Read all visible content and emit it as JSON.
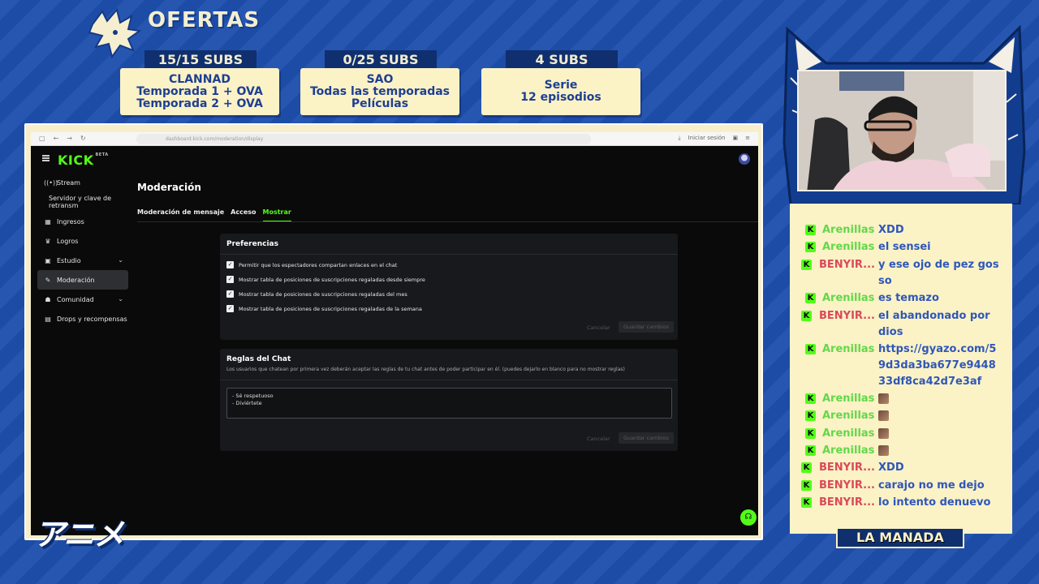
{
  "overlay": {
    "offers_title": "OFERTAS",
    "offers": [
      {
        "tag": "15/15 SUBS",
        "lines": [
          "CLANNAD",
          "Temporada 1 + OVA",
          "Temporada 2 + OVA"
        ]
      },
      {
        "tag": "0/25 SUBS",
        "lines": [
          "SAO",
          "Todas las temporadas",
          "Películas"
        ]
      },
      {
        "tag": "4 SUBS",
        "lines": [
          "Serie",
          "12 episodios"
        ]
      }
    ],
    "bottom_logo": "アニメ",
    "team_label": "LA MANADA",
    "colors": {
      "background": "#1e4fae",
      "card": "#fbf2c6",
      "accent_dark": "#0f2f6e",
      "kick_green": "#53fc18"
    }
  },
  "browser": {
    "url": "dashboard.kick.com/moderation/display",
    "login_label": "Iniciar sesión"
  },
  "kick": {
    "logo": "KICK",
    "logo_badge": "BETA",
    "sidebar": [
      {
        "icon": "stream-icon",
        "glyph": "((•))",
        "label": "Stream"
      },
      {
        "icon": "",
        "glyph": "",
        "label": "Servidor y clave de retransm",
        "sub": true
      },
      {
        "icon": "income-icon",
        "glyph": "▦",
        "label": "Ingresos"
      },
      {
        "icon": "trophy-icon",
        "glyph": "♛",
        "label": "Logros"
      },
      {
        "icon": "studio-icon",
        "glyph": "▣",
        "label": "Estudio",
        "chevron": true
      },
      {
        "icon": "wrench-icon",
        "glyph": "✎",
        "label": "Moderación",
        "active": true
      },
      {
        "icon": "community-icon",
        "glyph": "☗",
        "label": "Comunidad",
        "chevron": true
      },
      {
        "icon": "gift-icon",
        "glyph": "▤",
        "label": "Drops y recompensas"
      }
    ],
    "page_title": "Moderación",
    "tabs": [
      {
        "label": "Moderación de mensaje",
        "active": false
      },
      {
        "label": "Acceso",
        "active": false
      },
      {
        "label": "Mostrar",
        "active": true
      }
    ],
    "preferences": {
      "title": "Preferencias",
      "options": [
        {
          "label": "Permitir que los espectadores compartan enlaces en el chat",
          "checked": true
        },
        {
          "label": "Mostrar tabla de posiciones de suscripciones regaladas desde siempre",
          "checked": true
        },
        {
          "label": "Mostrar tabla de posiciones de suscripciones regaladas del mes",
          "checked": true
        },
        {
          "label": "Mostrar tabla de posiciones de suscripciones regaladas de la semana",
          "checked": true
        }
      ],
      "cancel": "Cancelar",
      "save": "Guardar cambios"
    },
    "chat_rules": {
      "title": "Reglas del Chat",
      "description": "Los usuarios que chatean por primera vez deberán aceptar las reglas de tu chat antes de poder participar en él. (puedes dejarlo en blanco para no mostrar reglas)",
      "value": "- Sé respetuoso\n- Diviértete",
      "cancel": "Cancelar",
      "save": "Guardar cambios"
    }
  },
  "chat": {
    "messages": [
      {
        "user": "Arenillas",
        "color": "green",
        "text": "XDD"
      },
      {
        "user": "Arenillas",
        "color": "green",
        "text": "el sensei"
      },
      {
        "user": "BENYIR...",
        "color": "red",
        "text": "y ese ojo de pez gosso"
      },
      {
        "user": "Arenillas",
        "color": "green",
        "text": "es temazo"
      },
      {
        "user": "BENYIR...",
        "color": "red",
        "text": "el abandonado por dios"
      },
      {
        "user": "Arenillas",
        "color": "green",
        "text": "https://gyazo.com/59d3da3ba677e944833df8ca42d7e3af"
      },
      {
        "user": "Arenillas",
        "color": "green",
        "text": "",
        "emote": true
      },
      {
        "user": "Arenillas",
        "color": "green",
        "text": "",
        "emote": true
      },
      {
        "user": "Arenillas",
        "color": "green",
        "text": "",
        "emote": true
      },
      {
        "user": "Arenillas",
        "color": "green",
        "text": "",
        "emote": true
      },
      {
        "user": "BENYIR...",
        "color": "red",
        "text": "XDD"
      },
      {
        "user": "BENYIR...",
        "color": "red",
        "text": "carajo no me dejo"
      },
      {
        "user": "BENYIR...",
        "color": "red",
        "text": "lo intento denuevo"
      }
    ]
  }
}
